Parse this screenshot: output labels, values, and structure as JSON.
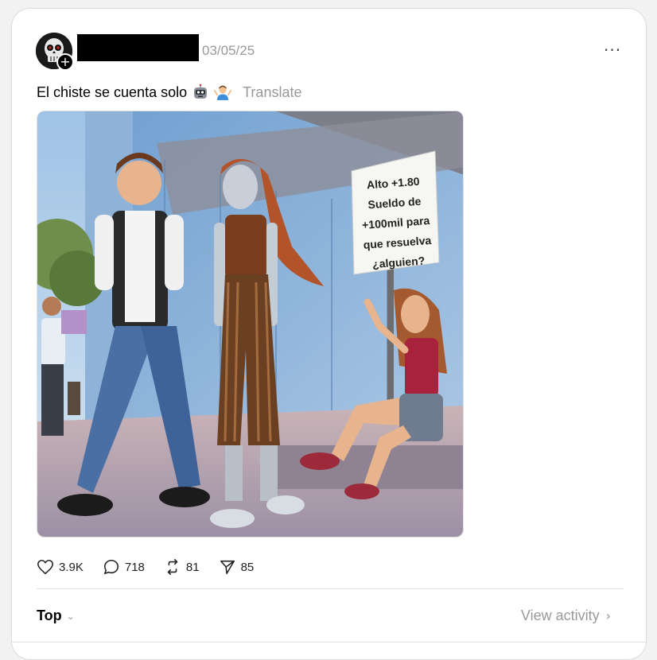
{
  "post": {
    "date": "03/05/25",
    "more_label": "···",
    "caption": "El chiste se cuenta solo",
    "translate_label": "Translate",
    "follow_label": "+"
  },
  "image": {
    "sign_lines": [
      "Alto +1.80",
      "Sueldo de",
      "+100mil para",
      "que resuelva",
      "¿alguien?"
    ]
  },
  "actions": {
    "likes": "3.9K",
    "replies": "718",
    "reposts": "81",
    "shares": "85"
  },
  "footer": {
    "sort_label": "Top",
    "activity_label": "View activity"
  },
  "colors": {
    "date_gray": "#999999",
    "text": "#000000"
  }
}
